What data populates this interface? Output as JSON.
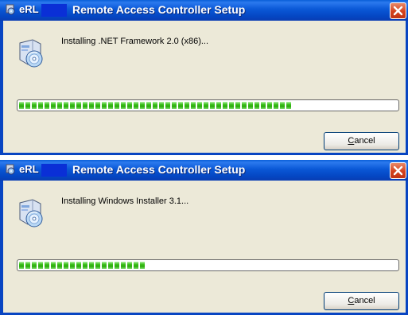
{
  "windows": [
    {
      "app_name": "eRL",
      "title": "Remote Access Controller Setup",
      "status": "Installing .NET Framework 2.0 (x86)...",
      "progress_percent": 73,
      "cancel_label": "Cancel",
      "cancel_hotkey": "C",
      "cancel_rest": "ancel"
    },
    {
      "app_name": "eRL",
      "title": "Remote Access Controller Setup",
      "status": "Installing Windows Installer 3.1...",
      "progress_percent": 33,
      "cancel_label": "Cancel",
      "cancel_hotkey": "C",
      "cancel_rest": "ancel"
    }
  ],
  "icons": [
    "app-icon",
    "close-icon",
    "setup-icon"
  ],
  "colors": {
    "titlebar": "#0a58d6",
    "client": "#ece9d8",
    "close": "#d4421d",
    "progress": "#2aaa0a"
  }
}
